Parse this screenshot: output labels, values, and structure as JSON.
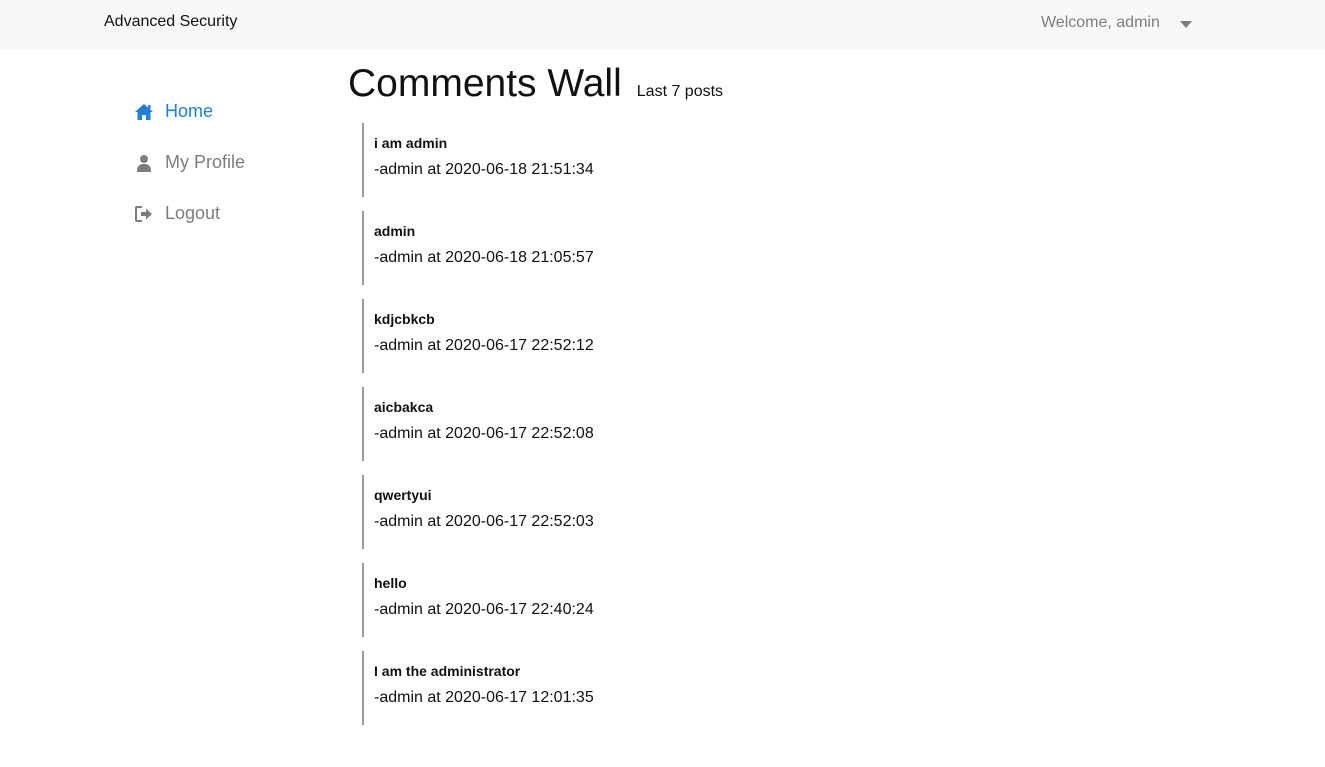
{
  "header": {
    "brand": "Advanced Security",
    "welcome": "Welcome, admin"
  },
  "sidebar": {
    "items": [
      {
        "label": "Home",
        "icon": "home-icon",
        "active": true
      },
      {
        "label": "My Profile",
        "icon": "user-icon",
        "active": false
      },
      {
        "label": "Logout",
        "icon": "logout-icon",
        "active": false
      }
    ]
  },
  "main": {
    "title": "Comments Wall",
    "subtitle": "Last 7 posts",
    "posts": [
      {
        "body": "i am admin",
        "meta": "-admin at 2020-06-18 21:51:34"
      },
      {
        "body": "admin",
        "meta": "-admin at 2020-06-18 21:05:57"
      },
      {
        "body": "kdjcbkcb",
        "meta": "-admin at 2020-06-17 22:52:12"
      },
      {
        "body": "aicbakca",
        "meta": "-admin at 2020-06-17 22:52:08"
      },
      {
        "body": "qwertyui",
        "meta": "-admin at 2020-06-17 22:52:03"
      },
      {
        "body": "hello",
        "meta": "-admin at 2020-06-17 22:40:24"
      },
      {
        "body": "I am the administrator",
        "meta": "-admin at 2020-06-17 12:01:35"
      }
    ]
  },
  "colors": {
    "accent": "#1e7fd8",
    "muted": "#7d7d7d",
    "topbar_bg": "#f8f8f8"
  }
}
